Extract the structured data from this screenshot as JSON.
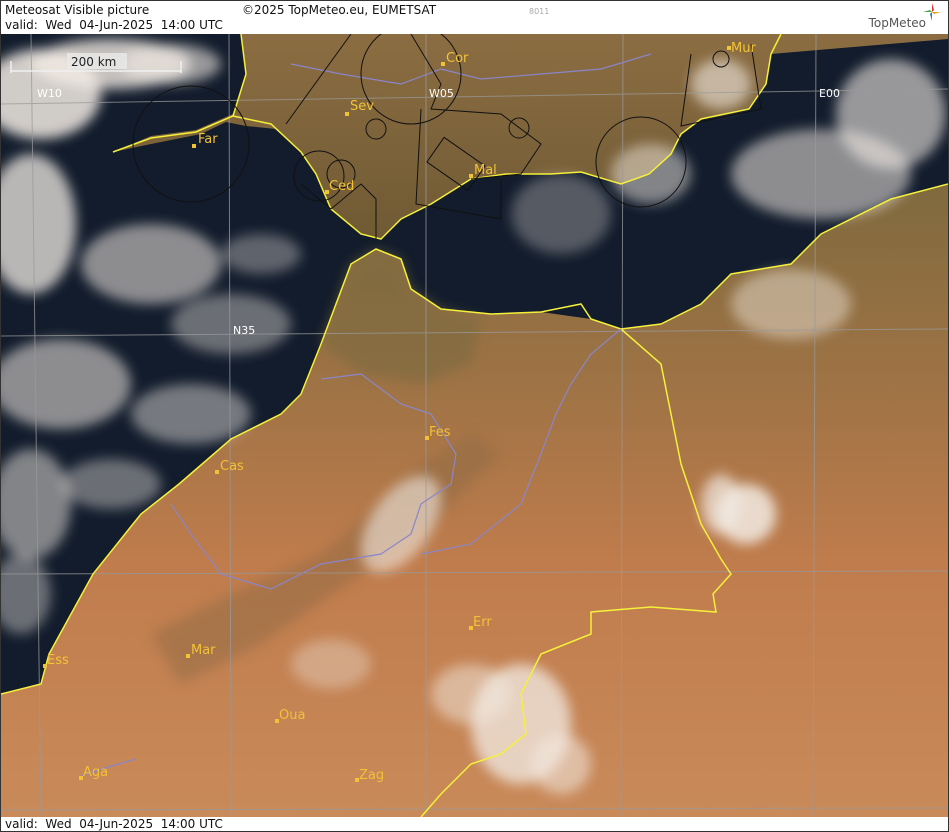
{
  "header": {
    "title": "Meteosat Visible picture",
    "valid": "valid:  Wed  04-Jun-2025  14:00 UTC",
    "copyright": "©2025 TopMeteo.eu, EUMETSAT",
    "code": "8011",
    "logo": "TopMeteo"
  },
  "footer": {
    "valid": "valid:  Wed  04-Jun-2025  14:00 UTC"
  },
  "scale_bar": {
    "label": "200 km"
  },
  "grid_labels": {
    "w10": "W10",
    "w05": "W05",
    "e00": "E00",
    "n35": "N35"
  },
  "cities": {
    "cor": "Cor",
    "sev": "Sev",
    "mur": "Mur",
    "far": "Far",
    "ced": "Ced",
    "mal": "Mal",
    "fes": "Fes",
    "cas": "Cas",
    "ess": "Ess",
    "mar": "Mar",
    "err": "Err",
    "oua": "Oua",
    "aga": "Aga",
    "zag": "Zag"
  },
  "colors": {
    "sea": "#121c2c",
    "land": "#bf7a4a",
    "land_north": "#8a6b40",
    "clouds": "#f2ebe4",
    "coast_border": "#f5f03a",
    "river": "#8a86c8",
    "city": "#f2c236",
    "grid": "#9a9a9a"
  }
}
